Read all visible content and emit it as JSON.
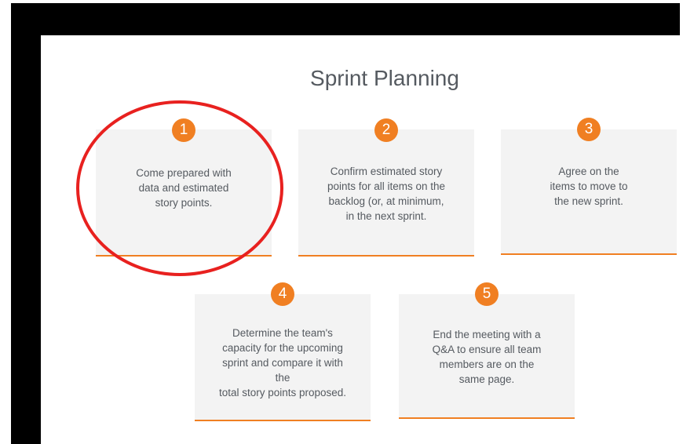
{
  "title": "Sprint Planning",
  "colors": {
    "accent": "#f07f22",
    "card_bg": "#f3f3f3",
    "text": "#555a60",
    "highlight": "#e8211f"
  },
  "steps": [
    {
      "number": "1",
      "text": "Come prepared with\ndata and estimated\nstory points."
    },
    {
      "number": "2",
      "text": "Confirm estimated story\npoints for all items on the\nbacklog (or, at minimum,\nin the next sprint."
    },
    {
      "number": "3",
      "text": "Agree on the\nitems to move to\nthe new sprint."
    },
    {
      "number": "4",
      "text": "Determine the team's\ncapacity for the upcoming\nsprint and compare it with the\ntotal story points proposed."
    },
    {
      "number": "5",
      "text": "End the meeting with a\nQ&A to ensure all team\nmembers are on the\nsame page."
    }
  ]
}
